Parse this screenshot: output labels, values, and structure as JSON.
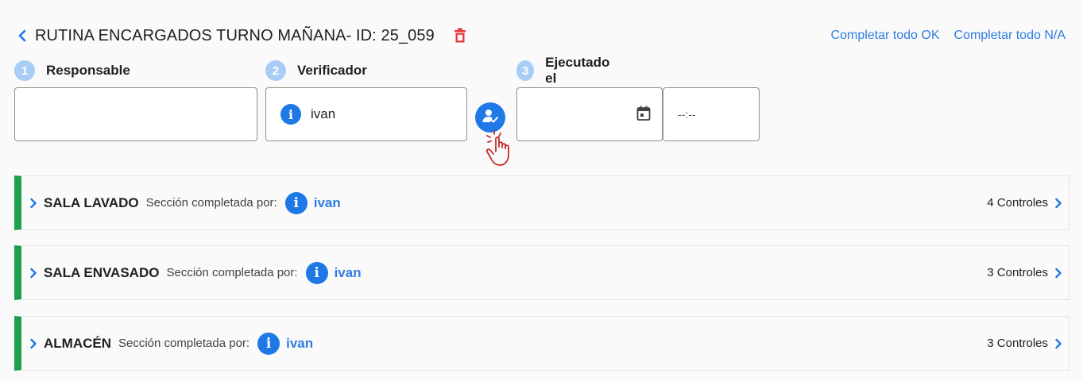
{
  "header": {
    "title": "RUTINA ENCARGADOS TURNO MAÑANA- ID: 25_059",
    "complete_ok": "Completar todo OK",
    "complete_na": "Completar todo N/A"
  },
  "steps": [
    {
      "num": "1",
      "label": "Responsable"
    },
    {
      "num": "2",
      "label": "Verificador"
    },
    {
      "num": "3",
      "label": "Ejecutado el"
    }
  ],
  "fields": {
    "responsable_value": "",
    "verificador_info": "i",
    "verificador_value": "ivan",
    "date_value": "",
    "time_value": "--:--"
  },
  "sections": [
    {
      "name": "SALA LAVADO",
      "completed_label": "Sección completada por:",
      "info": "i",
      "user": "ivan",
      "controls": "4 Controles"
    },
    {
      "name": "SALA ENVASADO",
      "completed_label": "Sección completada por:",
      "info": "i",
      "user": "ivan",
      "controls": "3 Controles"
    },
    {
      "name": "ALMACÉN",
      "completed_label": "Sección completada por:",
      "info": "i",
      "user": "ivan",
      "controls": "3 Controles"
    }
  ],
  "colors": {
    "accent": "#1e78e6",
    "link": "#2f7de1",
    "danger": "#e53935",
    "section_done": "#1aa14a",
    "step_badge": "#a9cdf6"
  },
  "icons": [
    "chevron-left-icon",
    "trash-icon",
    "info-icon",
    "assign-user-icon",
    "hand-pointer-icon",
    "calendar-icon",
    "chevron-right-icon"
  ]
}
